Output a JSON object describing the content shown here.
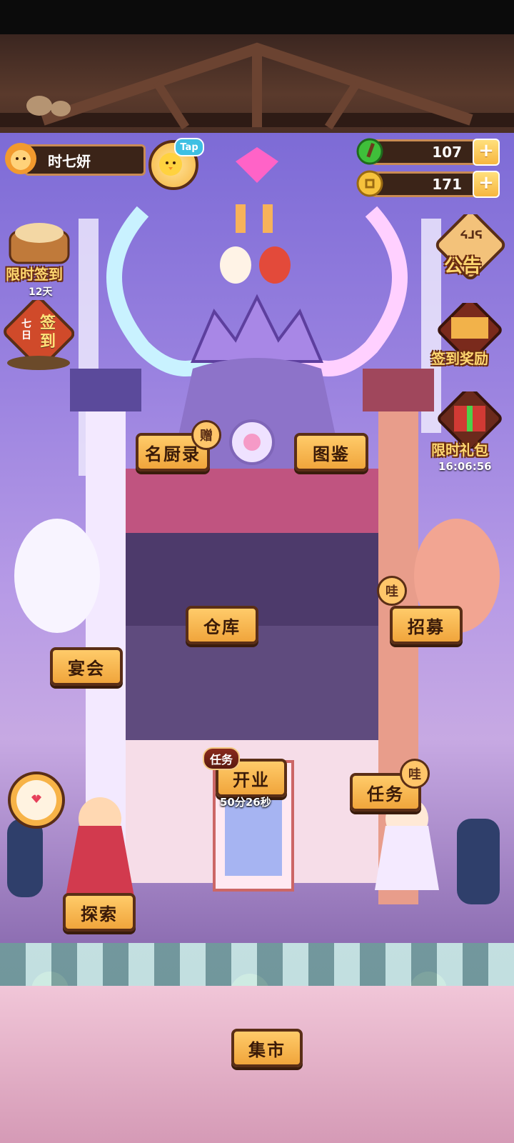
{
  "player": {
    "name": "时七妍",
    "tap_tag": "Tap"
  },
  "resources": {
    "gems": {
      "value": "107",
      "icon": "green-gem-icon"
    },
    "coins": {
      "value": "171",
      "icon": "gold-coin-icon"
    },
    "plus_symbol": "+"
  },
  "left_menu": {
    "limited_signin": {
      "label": "限时签到",
      "days": "12天"
    },
    "seven_day_signin": {
      "label_small": "七日",
      "label_big": "签到"
    }
  },
  "right_menu": {
    "notice": {
      "label": "公告",
      "glyphs": "ᔦᒧᕋ"
    },
    "signin_reward": {
      "label": "签到奖励"
    },
    "limited_pack": {
      "label": "限时礼包",
      "timer": "16:06:56"
    }
  },
  "buildings": {
    "chef_record": {
      "label": "名厨录",
      "badge": "赠"
    },
    "catalog": {
      "label": "图鉴"
    },
    "warehouse": {
      "label": "仓库"
    },
    "recruit": {
      "label": "招募",
      "badge": "哇"
    },
    "banquet": {
      "label": "宴会"
    },
    "open_business": {
      "label": "开业",
      "tag": "任务",
      "timer": "50分26秒"
    },
    "tasks": {
      "label": "任务",
      "badge": "哇"
    },
    "explore": {
      "label": "探索"
    },
    "market": {
      "label": "集市"
    }
  },
  "colors": {
    "button_fill": "#f6b640",
    "button_border": "#5a2e16",
    "sky": "#9b83e0",
    "label_gold": "#ffd870"
  }
}
